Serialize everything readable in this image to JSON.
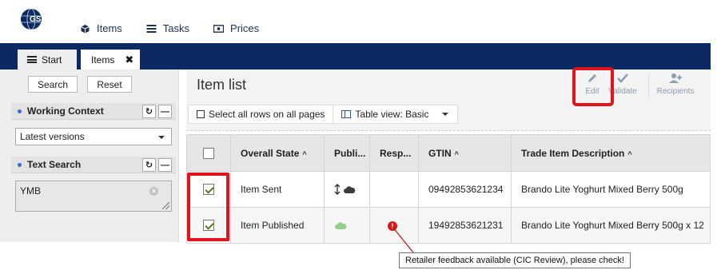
{
  "logo": {
    "text": "GS1"
  },
  "topnav": [
    {
      "label": "Items",
      "icon": "cube-icon"
    },
    {
      "label": "Tasks",
      "icon": "tasks-icon"
    },
    {
      "label": "Prices",
      "icon": "price-icon"
    }
  ],
  "tabs": {
    "start": "Start",
    "items": "Items"
  },
  "left": {
    "search_button": "Search",
    "reset_button": "Reset",
    "working_context": {
      "title": "Working Context",
      "selected": "Latest versions"
    },
    "text_search": {
      "title": "Text Search",
      "value": "YMB"
    }
  },
  "main": {
    "title": "Item list",
    "select_all": "Select all rows on all pages",
    "table_view": "Table view: Basic",
    "actions": {
      "edit": "Edit",
      "validate": "Validate",
      "recipients": "Recipients"
    }
  },
  "table": {
    "headers": [
      "",
      "Overall State",
      "Publi...",
      "Resp...",
      "GTIN",
      "Trade Item Description"
    ],
    "rows": [
      {
        "checked": true,
        "state": "Item Sent",
        "gtin": "09492853621234",
        "description": "Brando Lite Yoghurt Mixed Berry 500g"
      },
      {
        "checked": true,
        "state": "Item Published",
        "gtin": "19492853621231",
        "description": "Brando Lite Yoghurt Mixed Berry 500g x 12"
      }
    ]
  },
  "tooltip": "Retailer feedback available (CIC Review), please check!",
  "colors": {
    "navy": "#0b2a63",
    "highlight": "#e1141c",
    "cloud_dark": "#3b3b3b",
    "cloud_green": "#8fcf8a",
    "error": "#d61a1a"
  }
}
